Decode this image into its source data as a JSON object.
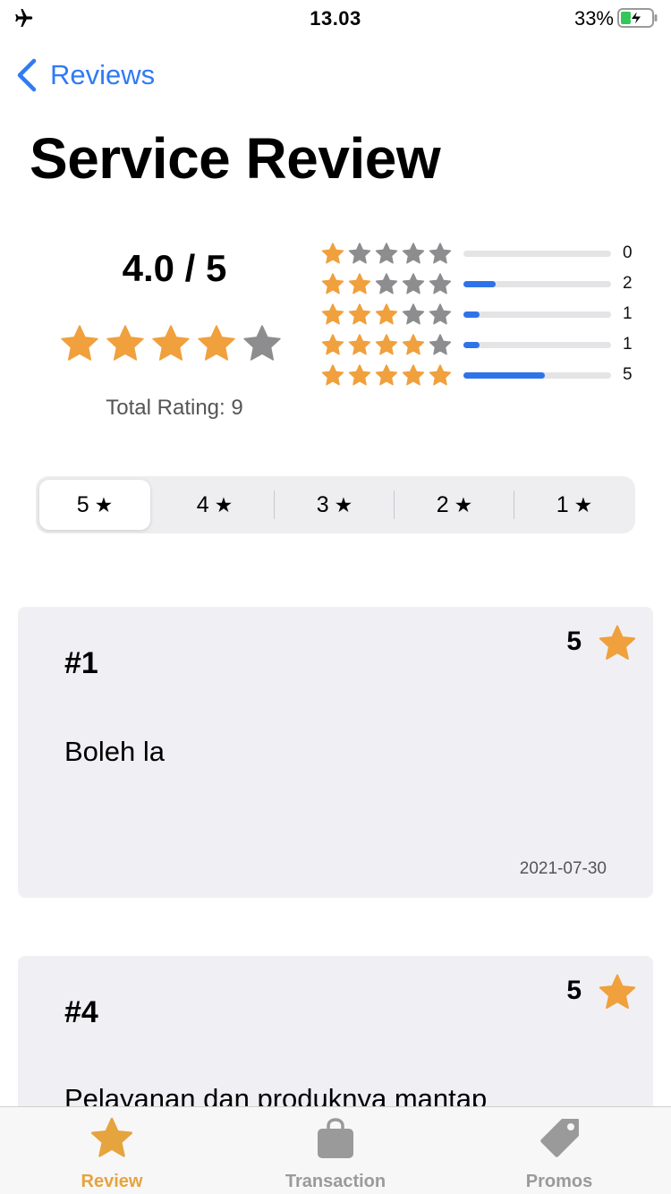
{
  "status_bar": {
    "time": "13.03",
    "battery": "33%"
  },
  "nav": {
    "back_label": "Reviews"
  },
  "title": "Service Review",
  "summary": {
    "average": "4.0 / 5",
    "average_value": 4,
    "total_label": "Total Rating: 9",
    "distribution": [
      {
        "stars": 1,
        "count": "0",
        "fraction": 0.0
      },
      {
        "stars": 2,
        "count": "2",
        "fraction": 0.22
      },
      {
        "stars": 3,
        "count": "1",
        "fraction": 0.11
      },
      {
        "stars": 4,
        "count": "1",
        "fraction": 0.11
      },
      {
        "stars": 5,
        "count": "5",
        "fraction": 0.55
      }
    ]
  },
  "filter": {
    "selected": "5",
    "options": [
      {
        "label": "5",
        "icon": "star-icon"
      },
      {
        "label": "4",
        "icon": "star-icon"
      },
      {
        "label": "3",
        "icon": "star-icon"
      },
      {
        "label": "2",
        "icon": "star-icon"
      },
      {
        "label": "1",
        "icon": "star-icon"
      }
    ]
  },
  "reviews": [
    {
      "id": "#1",
      "rating": "5",
      "text": "Boleh la",
      "date": "2021-07-30"
    },
    {
      "id": "#4",
      "rating": "5",
      "text": "Pelayanan dan produknya mantap"
    }
  ],
  "tabs": [
    {
      "label": "Review",
      "icon": "star-icon",
      "active": true
    },
    {
      "label": "Transaction",
      "icon": "bag-icon",
      "active": false
    },
    {
      "label": "Promos",
      "icon": "tag-icon",
      "active": false
    }
  ],
  "colors": {
    "accent": "#2f7bf5",
    "star_filled": "#f0a03c",
    "star_empty": "#8d8d8f",
    "bar_fill": "#2f73e8",
    "tab_active": "#e6a43e"
  }
}
